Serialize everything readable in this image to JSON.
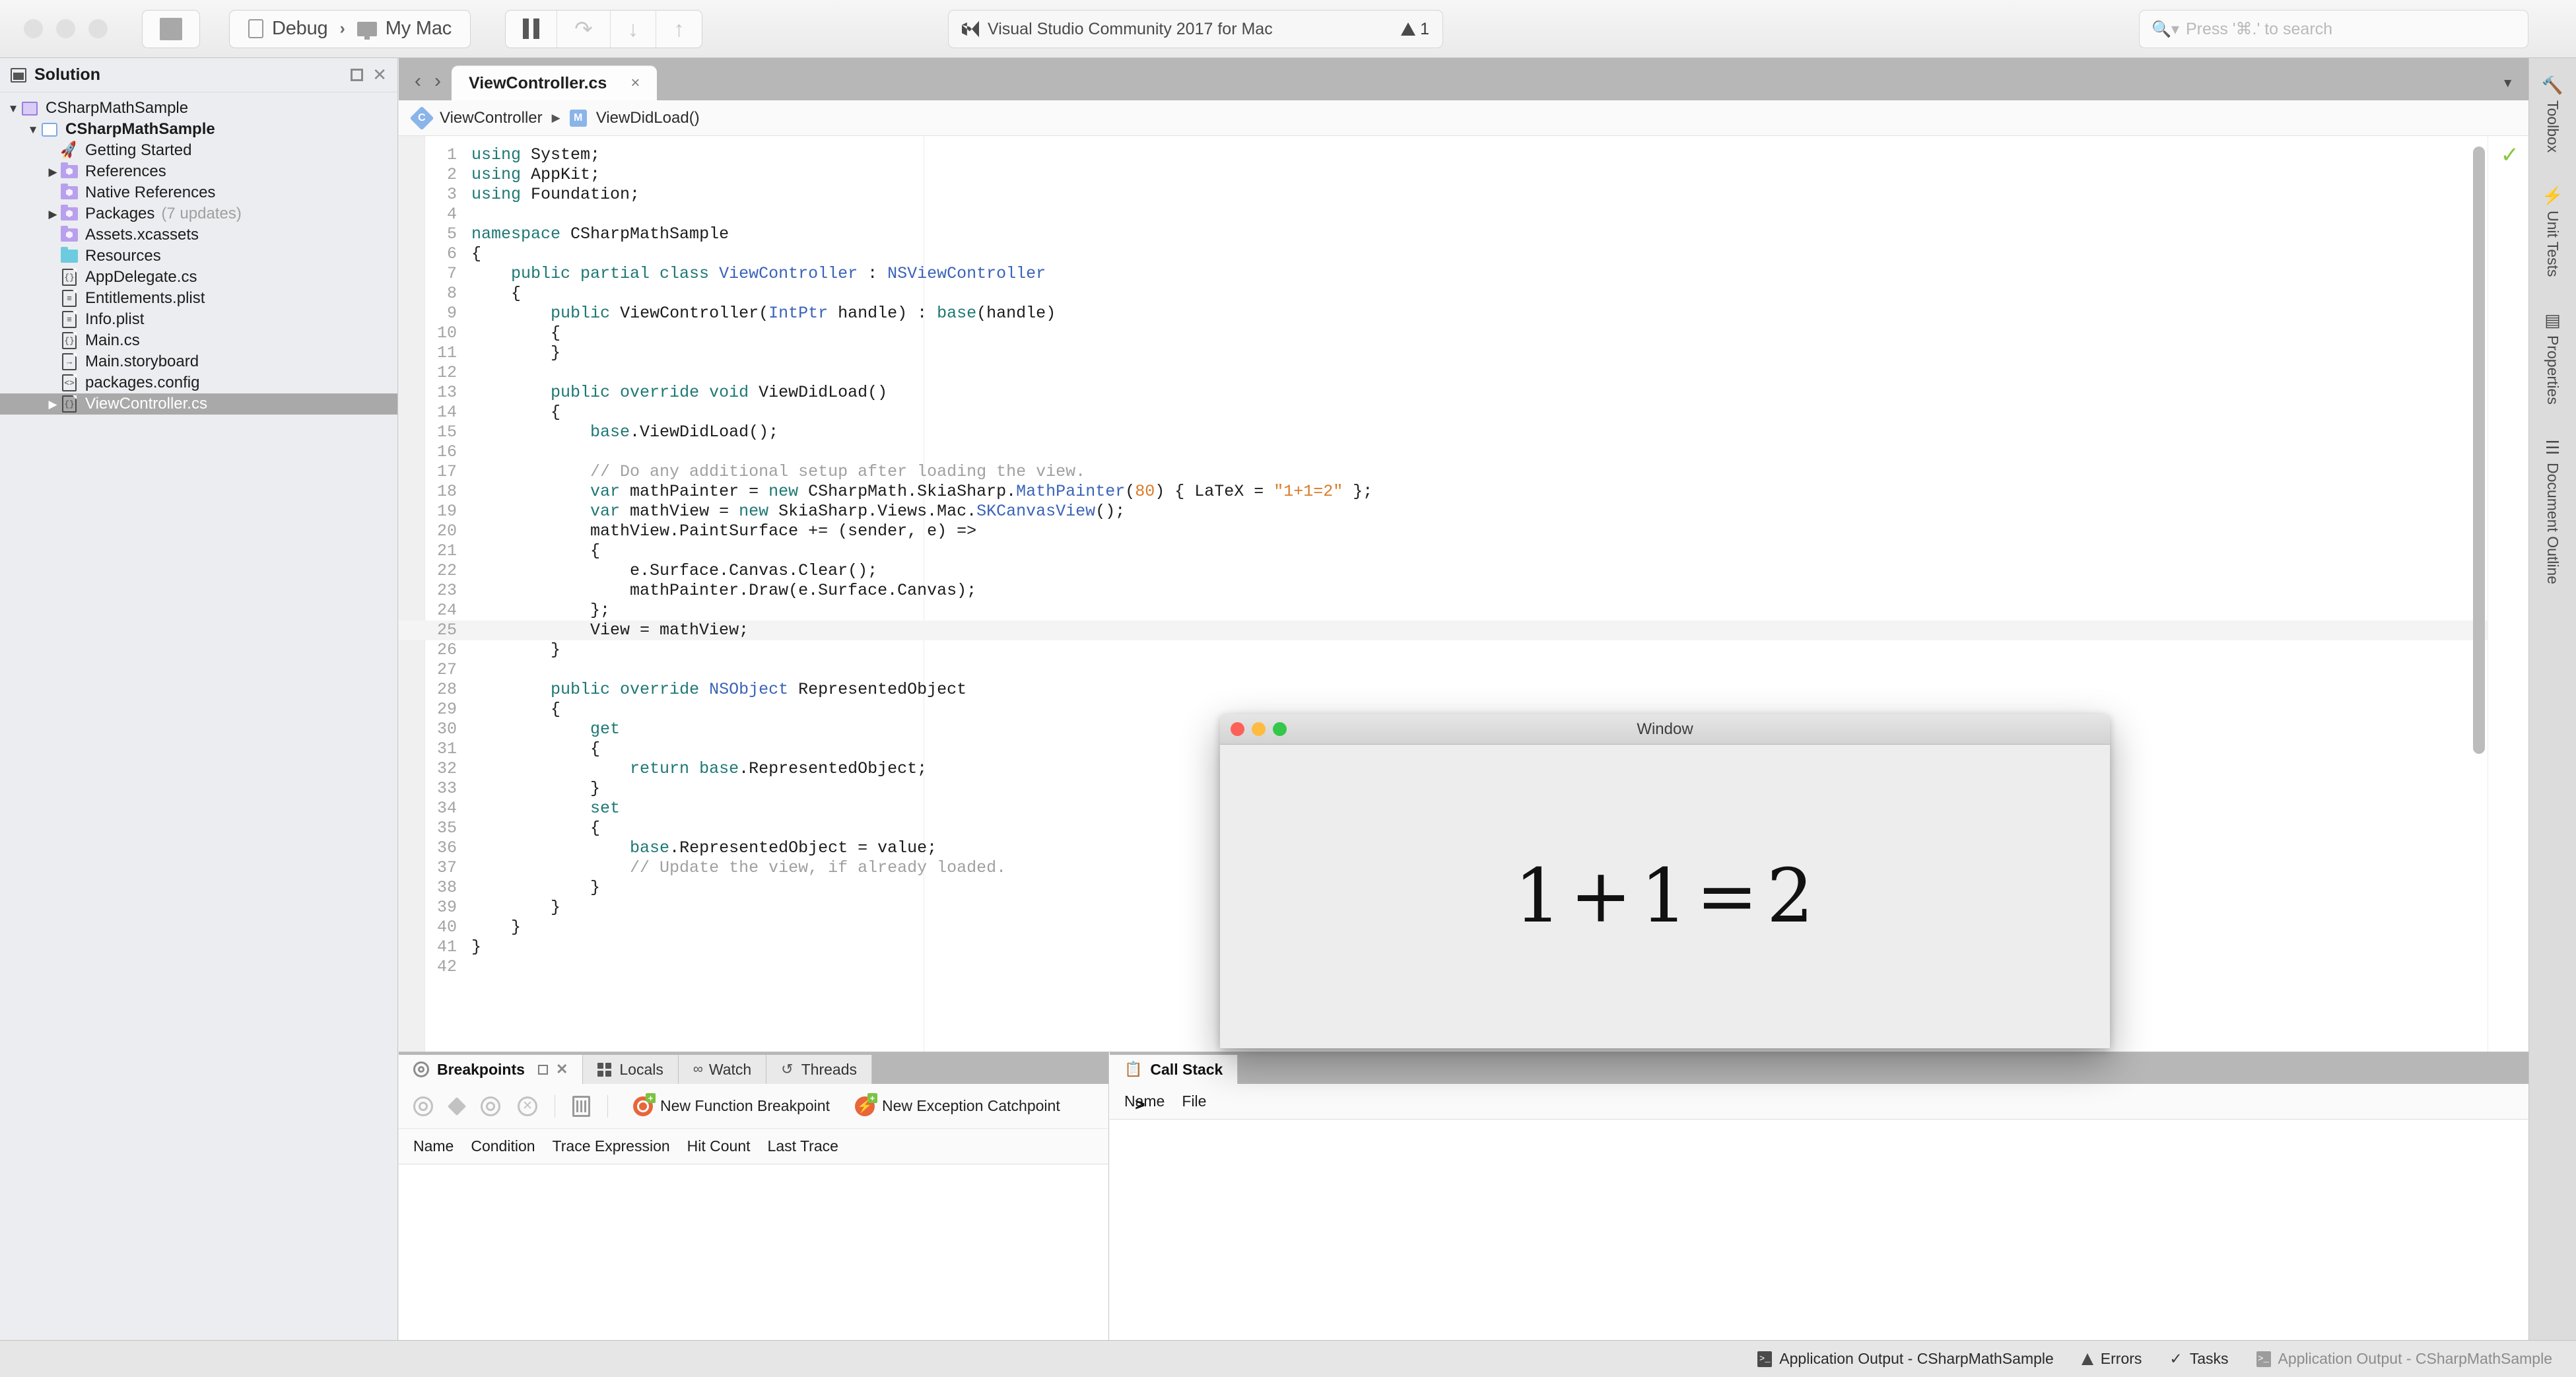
{
  "toolbar": {
    "stop_button": "stop-icon",
    "configuration": "Debug",
    "device": "My Mac",
    "config_separator": "›",
    "pause_button": "pause-icon",
    "step_over_button": "↷",
    "step_into_button": "↓",
    "step_out_button": "↑",
    "status_title": "Visual Studio Community 2017 for Mac",
    "warning_count": "1",
    "search_placeholder": "Press '⌘.' to search",
    "search_value": ""
  },
  "solution_pad": {
    "title": "Solution",
    "pin_label": "pin",
    "close_label": "close",
    "tree": [
      {
        "label": "CSharpMathSample",
        "sub": "",
        "indent": 0,
        "twisty": "▼",
        "icon": "solution-icon",
        "selected": false,
        "bold": false
      },
      {
        "label": "CSharpMathSample",
        "sub": "",
        "indent": 1,
        "twisty": "▼",
        "icon": "project-icon",
        "selected": false,
        "bold": true
      },
      {
        "label": "Getting Started",
        "sub": "",
        "indent": 2,
        "twisty": "",
        "icon": "rocket-icon",
        "selected": false,
        "bold": false
      },
      {
        "label": "References",
        "sub": "",
        "indent": 2,
        "twisty": "▶",
        "icon": "folder-purple-icon",
        "selected": false,
        "bold": false
      },
      {
        "label": "Native References",
        "sub": "",
        "indent": 2,
        "twisty": "",
        "icon": "folder-purple-icon",
        "selected": false,
        "bold": false
      },
      {
        "label": "Packages",
        "sub": "(7 updates)",
        "indent": 2,
        "twisty": "▶",
        "icon": "folder-purple-icon",
        "selected": false,
        "bold": false
      },
      {
        "label": "Assets.xcassets",
        "sub": "",
        "indent": 2,
        "twisty": "",
        "icon": "folder-purple-icon",
        "selected": false,
        "bold": false
      },
      {
        "label": "Resources",
        "sub": "",
        "indent": 2,
        "twisty": "",
        "icon": "folder-cyan-icon",
        "selected": false,
        "bold": false
      },
      {
        "label": "AppDelegate.cs",
        "sub": "",
        "indent": 2,
        "twisty": "",
        "icon": "csharp-file-icon",
        "selected": false,
        "bold": false
      },
      {
        "label": "Entitlements.plist",
        "sub": "",
        "indent": 2,
        "twisty": "",
        "icon": "plist-file-icon",
        "selected": false,
        "bold": false
      },
      {
        "label": "Info.plist",
        "sub": "",
        "indent": 2,
        "twisty": "",
        "icon": "plist-file-icon",
        "selected": false,
        "bold": false
      },
      {
        "label": "Main.cs",
        "sub": "",
        "indent": 2,
        "twisty": "",
        "icon": "csharp-file-icon",
        "selected": false,
        "bold": false
      },
      {
        "label": "Main.storyboard",
        "sub": "",
        "indent": 2,
        "twisty": "",
        "icon": "storyboard-file-icon",
        "selected": false,
        "bold": false
      },
      {
        "label": "packages.config",
        "sub": "",
        "indent": 2,
        "twisty": "",
        "icon": "xml-file-icon",
        "selected": false,
        "bold": false
      },
      {
        "label": "ViewController.cs",
        "sub": "",
        "indent": 2,
        "twisty": "▶",
        "icon": "csharp-file-icon",
        "selected": true,
        "bold": false
      }
    ]
  },
  "editor": {
    "back_arrow": "‹",
    "forward_arrow": "›",
    "tab_label": "ViewController.cs",
    "tab_close": "×",
    "tab_overflow": "▼",
    "breadcrumb_class": "ViewController",
    "breadcrumb_class_badge": "C",
    "breadcrumb_arrow": "▶",
    "breadcrumb_member": "ViewDidLoad()",
    "breadcrumb_member_badge": "M",
    "status_check": "✓",
    "current_line": 25,
    "lines": [
      {
        "n": 1,
        "tokens": [
          {
            "t": "using ",
            "c": "k"
          },
          {
            "t": "System;",
            "c": ""
          }
        ]
      },
      {
        "n": 2,
        "tokens": [
          {
            "t": "using ",
            "c": "k"
          },
          {
            "t": "AppKit;",
            "c": ""
          }
        ]
      },
      {
        "n": 3,
        "tokens": [
          {
            "t": "using ",
            "c": "k"
          },
          {
            "t": "Foundation;",
            "c": ""
          }
        ]
      },
      {
        "n": 4,
        "tokens": [
          {
            "t": "",
            "c": ""
          }
        ]
      },
      {
        "n": 5,
        "tokens": [
          {
            "t": "namespace ",
            "c": "k"
          },
          {
            "t": "CSharpMathSample",
            "c": ""
          }
        ]
      },
      {
        "n": 6,
        "tokens": [
          {
            "t": "{",
            "c": ""
          }
        ]
      },
      {
        "n": 7,
        "tokens": [
          {
            "t": "    ",
            "c": ""
          },
          {
            "t": "public partial class ",
            "c": "k"
          },
          {
            "t": "ViewController",
            "c": "t"
          },
          {
            "t": " : ",
            "c": ""
          },
          {
            "t": "NSViewController",
            "c": "t"
          }
        ]
      },
      {
        "n": 8,
        "tokens": [
          {
            "t": "    {",
            "c": ""
          }
        ]
      },
      {
        "n": 9,
        "tokens": [
          {
            "t": "        ",
            "c": ""
          },
          {
            "t": "public ",
            "c": "k"
          },
          {
            "t": "ViewController(",
            "c": ""
          },
          {
            "t": "IntPtr",
            "c": "t"
          },
          {
            "t": " handle) : ",
            "c": ""
          },
          {
            "t": "base",
            "c": "k"
          },
          {
            "t": "(handle)",
            "c": ""
          }
        ]
      },
      {
        "n": 10,
        "tokens": [
          {
            "t": "        {",
            "c": ""
          }
        ]
      },
      {
        "n": 11,
        "tokens": [
          {
            "t": "        }",
            "c": ""
          }
        ]
      },
      {
        "n": 12,
        "tokens": [
          {
            "t": "",
            "c": ""
          }
        ]
      },
      {
        "n": 13,
        "tokens": [
          {
            "t": "        ",
            "c": ""
          },
          {
            "t": "public override void ",
            "c": "k"
          },
          {
            "t": "ViewDidLoad()",
            "c": ""
          }
        ]
      },
      {
        "n": 14,
        "tokens": [
          {
            "t": "        {",
            "c": ""
          }
        ]
      },
      {
        "n": 15,
        "tokens": [
          {
            "t": "            ",
            "c": ""
          },
          {
            "t": "base",
            "c": "k"
          },
          {
            "t": ".ViewDidLoad();",
            "c": ""
          }
        ]
      },
      {
        "n": 16,
        "tokens": [
          {
            "t": "",
            "c": ""
          }
        ]
      },
      {
        "n": 17,
        "tokens": [
          {
            "t": "            ",
            "c": ""
          },
          {
            "t": "// Do any additional setup after loading the view.",
            "c": "c"
          }
        ]
      },
      {
        "n": 18,
        "tokens": [
          {
            "t": "            ",
            "c": ""
          },
          {
            "t": "var",
            "c": "k"
          },
          {
            "t": " mathPainter = ",
            "c": ""
          },
          {
            "t": "new",
            "c": "k"
          },
          {
            "t": " CSharpMath.SkiaSharp.",
            "c": ""
          },
          {
            "t": "MathPainter",
            "c": "t"
          },
          {
            "t": "(",
            "c": ""
          },
          {
            "t": "80",
            "c": "n"
          },
          {
            "t": ") { LaTeX = ",
            "c": ""
          },
          {
            "t": "\"1+1=2\"",
            "c": "s"
          },
          {
            "t": " };",
            "c": ""
          }
        ]
      },
      {
        "n": 19,
        "tokens": [
          {
            "t": "            ",
            "c": ""
          },
          {
            "t": "var",
            "c": "k"
          },
          {
            "t": " mathView = ",
            "c": ""
          },
          {
            "t": "new",
            "c": "k"
          },
          {
            "t": " SkiaSharp.Views.Mac.",
            "c": ""
          },
          {
            "t": "SKCanvasView",
            "c": "t"
          },
          {
            "t": "();",
            "c": ""
          }
        ]
      },
      {
        "n": 20,
        "tokens": [
          {
            "t": "            mathView.PaintSurface += (sender, e) =>",
            "c": ""
          }
        ]
      },
      {
        "n": 21,
        "tokens": [
          {
            "t": "            {",
            "c": ""
          }
        ]
      },
      {
        "n": 22,
        "tokens": [
          {
            "t": "                e.Surface.Canvas.Clear();",
            "c": ""
          }
        ]
      },
      {
        "n": 23,
        "tokens": [
          {
            "t": "                mathPainter.Draw(e.Surface.Canvas);",
            "c": ""
          }
        ]
      },
      {
        "n": 24,
        "tokens": [
          {
            "t": "            };",
            "c": ""
          }
        ]
      },
      {
        "n": 25,
        "tokens": [
          {
            "t": "            View = mathView;",
            "c": ""
          }
        ]
      },
      {
        "n": 26,
        "tokens": [
          {
            "t": "        }",
            "c": ""
          }
        ]
      },
      {
        "n": 27,
        "tokens": [
          {
            "t": "",
            "c": ""
          }
        ]
      },
      {
        "n": 28,
        "tokens": [
          {
            "t": "        ",
            "c": ""
          },
          {
            "t": "public override ",
            "c": "k"
          },
          {
            "t": "NSObject",
            "c": "t"
          },
          {
            "t": " RepresentedObject",
            "c": ""
          }
        ]
      },
      {
        "n": 29,
        "tokens": [
          {
            "t": "        {",
            "c": ""
          }
        ]
      },
      {
        "n": 30,
        "tokens": [
          {
            "t": "            ",
            "c": ""
          },
          {
            "t": "get",
            "c": "k"
          }
        ]
      },
      {
        "n": 31,
        "tokens": [
          {
            "t": "            {",
            "c": ""
          }
        ]
      },
      {
        "n": 32,
        "tokens": [
          {
            "t": "                ",
            "c": ""
          },
          {
            "t": "return base",
            "c": "k"
          },
          {
            "t": ".RepresentedObject;",
            "c": ""
          }
        ]
      },
      {
        "n": 33,
        "tokens": [
          {
            "t": "            }",
            "c": ""
          }
        ]
      },
      {
        "n": 34,
        "tokens": [
          {
            "t": "            ",
            "c": ""
          },
          {
            "t": "set",
            "c": "k"
          }
        ]
      },
      {
        "n": 35,
        "tokens": [
          {
            "t": "            {",
            "c": ""
          }
        ]
      },
      {
        "n": 36,
        "tokens": [
          {
            "t": "                ",
            "c": ""
          },
          {
            "t": "base",
            "c": "k"
          },
          {
            "t": ".RepresentedObject = value;",
            "c": ""
          }
        ]
      },
      {
        "n": 37,
        "tokens": [
          {
            "t": "                ",
            "c": ""
          },
          {
            "t": "// Update the view, if already loaded.",
            "c": "c"
          }
        ]
      },
      {
        "n": 38,
        "tokens": [
          {
            "t": "            }",
            "c": ""
          }
        ]
      },
      {
        "n": 39,
        "tokens": [
          {
            "t": "        }",
            "c": ""
          }
        ]
      },
      {
        "n": 40,
        "tokens": [
          {
            "t": "    }",
            "c": ""
          }
        ]
      },
      {
        "n": 41,
        "tokens": [
          {
            "t": "}",
            "c": ""
          }
        ]
      },
      {
        "n": 42,
        "tokens": [
          {
            "t": "",
            "c": ""
          }
        ]
      }
    ]
  },
  "breakpoints_pad": {
    "tabs": [
      {
        "label": "Breakpoints",
        "icon": "breakpoint-icon",
        "active": true
      },
      {
        "label": "Locals",
        "icon": "locals-icon",
        "active": false
      },
      {
        "label": "Watch",
        "icon": "watch-icon",
        "active": false
      },
      {
        "label": "Threads",
        "icon": "threads-icon",
        "active": false
      }
    ],
    "pin_label": "pin",
    "close_label": "close",
    "new_function_breakpoint": "New Function Breakpoint",
    "new_exception_catchpoint": "New Exception Catchpoint",
    "columns": [
      "Name",
      "Condition",
      "Trace Expression",
      "Hit Count",
      "Last Trace"
    ],
    "rows": []
  },
  "callstack_pad": {
    "title": "Call Stack",
    "columns": [
      "Name",
      "File"
    ],
    "prompt": ">",
    "rows": []
  },
  "right_sidebar": {
    "items": [
      {
        "label": "Toolbox",
        "icon": "hammer-icon"
      },
      {
        "label": "Unit Tests",
        "icon": "bolt-icon"
      },
      {
        "label": "Properties",
        "icon": "properties-icon"
      },
      {
        "label": "Document Outline",
        "icon": "outline-icon"
      }
    ]
  },
  "statusbar": {
    "items": [
      {
        "label": "Application Output - CSharpMathSample",
        "icon": "console-icon",
        "dim": false
      },
      {
        "label": "Errors",
        "icon": "warning-icon",
        "dim": false
      },
      {
        "label": "Tasks",
        "icon": "check-icon",
        "dim": false
      },
      {
        "label": "Application Output - CSharpMathSample",
        "icon": "console-icon",
        "dim": true
      }
    ]
  },
  "app_window": {
    "title": "Window",
    "close_label": "close",
    "minimize_label": "minimize",
    "zoom_label": "zoom",
    "math_left": "1",
    "math_plus": "+",
    "math_right": "1",
    "math_equals": "=",
    "math_result": "2"
  },
  "colors": {
    "keyword": "#1d7874",
    "type": "#3a63b8",
    "string": "#d97b28",
    "comment": "#a0a0a0",
    "accent_orange": "#e8663a",
    "ok_green": "#8cc63f",
    "selection_gray": "#a9a9a9"
  }
}
